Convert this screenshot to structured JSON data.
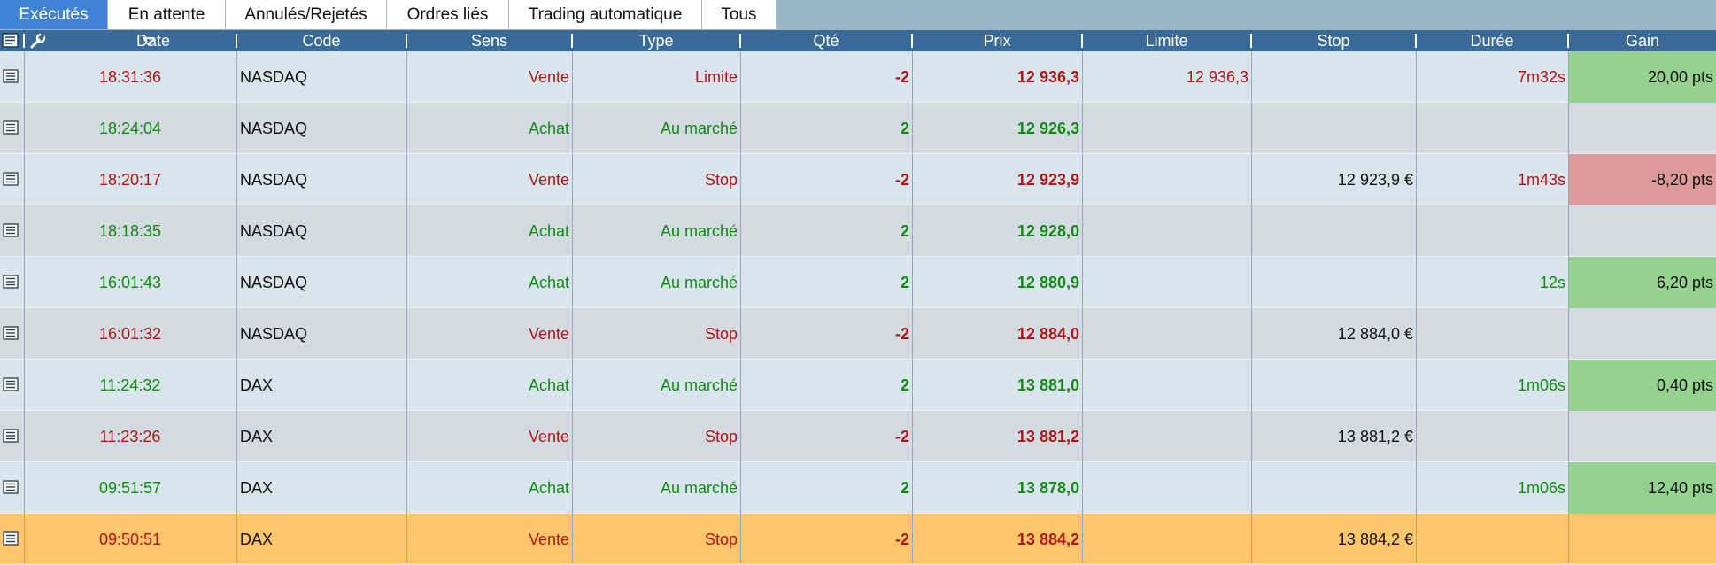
{
  "tabs": [
    {
      "label": "Exécutés",
      "active": true
    },
    {
      "label": "En attente",
      "active": false
    },
    {
      "label": "Annulés/Rejetés",
      "active": false
    },
    {
      "label": "Ordres liés",
      "active": false
    },
    {
      "label": "Trading automatique",
      "active": false
    },
    {
      "label": "Tous",
      "active": false
    }
  ],
  "columns": {
    "date": "Date",
    "code": "Code",
    "sens": "Sens",
    "type": "Type",
    "qte": "Qté",
    "prix": "Prix",
    "limite": "Limite",
    "stop": "Stop",
    "duree": "Durée",
    "gain": "Gain"
  },
  "colors": {
    "buy": "#118a11",
    "sell": "#b01515",
    "row_even": "#d9e5ec",
    "row_odd": "#d3dae1",
    "row_selected": "#ffc66a",
    "gain_pos": "#95d18f",
    "gain_neg": "#dc9a9b",
    "header": "#3a6a97",
    "tab_active": "#3f83d9"
  },
  "orders": [
    {
      "date": "18:31:36",
      "code": "NASDAQ",
      "sens": "Vente",
      "type": "Limite",
      "qte": "-2",
      "prix": "12 936,3",
      "limite": "12 936,3",
      "stop": "",
      "duree": "7m32s",
      "gain": "20,00 pts",
      "side": "sell",
      "gain_state": "pos"
    },
    {
      "date": "18:24:04",
      "code": "NASDAQ",
      "sens": "Achat",
      "type": "Au marché",
      "qte": "2",
      "prix": "12 926,3",
      "limite": "",
      "stop": "",
      "duree": "",
      "gain": "",
      "side": "buy",
      "gain_state": ""
    },
    {
      "date": "18:20:17",
      "code": "NASDAQ",
      "sens": "Vente",
      "type": "Stop",
      "qte": "-2",
      "prix": "12 923,9",
      "limite": "",
      "stop": "12 923,9 €",
      "duree": "1m43s",
      "gain": "-8,20 pts",
      "side": "sell",
      "gain_state": "neg"
    },
    {
      "date": "18:18:35",
      "code": "NASDAQ",
      "sens": "Achat",
      "type": "Au marché",
      "qte": "2",
      "prix": "12 928,0",
      "limite": "",
      "stop": "",
      "duree": "",
      "gain": "",
      "side": "buy",
      "gain_state": ""
    },
    {
      "date": "16:01:43",
      "code": "NASDAQ",
      "sens": "Achat",
      "type": "Au marché",
      "qte": "2",
      "prix": "12 880,9",
      "limite": "",
      "stop": "",
      "duree": "12s",
      "gain": "6,20 pts",
      "side": "buy",
      "gain_state": "pos"
    },
    {
      "date": "16:01:32",
      "code": "NASDAQ",
      "sens": "Vente",
      "type": "Stop",
      "qte": "-2",
      "prix": "12 884,0",
      "limite": "",
      "stop": "12 884,0 €",
      "duree": "",
      "gain": "",
      "side": "sell",
      "gain_state": ""
    },
    {
      "date": "11:24:32",
      "code": "DAX",
      "sens": "Achat",
      "type": "Au marché",
      "qte": "2",
      "prix": "13 881,0",
      "limite": "",
      "stop": "",
      "duree": "1m06s",
      "gain": "0,40 pts",
      "side": "buy",
      "gain_state": "pos"
    },
    {
      "date": "11:23:26",
      "code": "DAX",
      "sens": "Vente",
      "type": "Stop",
      "qte": "-2",
      "prix": "13 881,2",
      "limite": "",
      "stop": "13 881,2 €",
      "duree": "",
      "gain": "",
      "side": "sell",
      "gain_state": ""
    },
    {
      "date": "09:51:57",
      "code": "DAX",
      "sens": "Achat",
      "type": "Au marché",
      "qte": "2",
      "prix": "13 878,0",
      "limite": "",
      "stop": "",
      "duree": "1m06s",
      "gain": "12,40 pts",
      "side": "buy",
      "gain_state": "pos"
    },
    {
      "date": "09:50:51",
      "code": "DAX",
      "sens": "Vente",
      "type": "Stop",
      "qte": "-2",
      "prix": "13 884,2",
      "limite": "",
      "stop": "13 884,2 €",
      "duree": "",
      "gain": "",
      "side": "sell",
      "gain_state": "",
      "selected": true
    }
  ]
}
